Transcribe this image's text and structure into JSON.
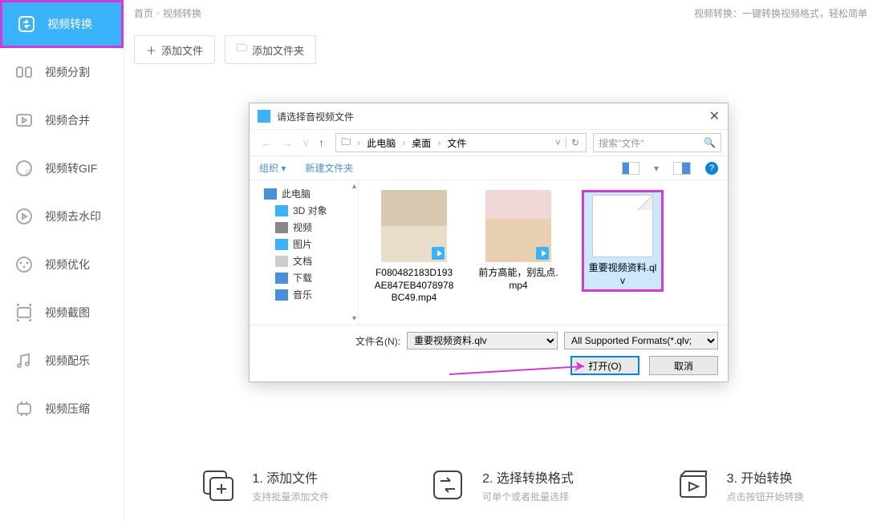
{
  "sidebar": {
    "items": [
      {
        "label": "视频转换"
      },
      {
        "label": "视频分割"
      },
      {
        "label": "视频合并"
      },
      {
        "label": "视频转GIF"
      },
      {
        "label": "视频去水印"
      },
      {
        "label": "视频优化"
      },
      {
        "label": "视频截图"
      },
      {
        "label": "视频配乐"
      },
      {
        "label": "视频压缩"
      }
    ]
  },
  "breadcrumb": {
    "home": "首页",
    "current": "视频转换"
  },
  "page_desc": "视频转换：一键转换视频格式，轻松简单",
  "toolbar": {
    "add_file": "添加文件",
    "add_folder": "添加文件夹"
  },
  "steps": [
    {
      "title": "1. 添加文件",
      "sub": "支持批量添加文件"
    },
    {
      "title": "2. 选择转换格式",
      "sub": "可单个或者批量选择"
    },
    {
      "title": "3. 开始转换",
      "sub": "点击按钮开始转换"
    }
  ],
  "dialog": {
    "title": "请选择音视频文件",
    "path": [
      "此电脑",
      "桌面",
      "文件"
    ],
    "search_placeholder": "搜索\"文件\"",
    "organize": "组织",
    "new_folder": "新建文件夹",
    "tree": [
      {
        "label": "此电脑"
      },
      {
        "label": "3D 对象"
      },
      {
        "label": "视频"
      },
      {
        "label": "图片"
      },
      {
        "label": "文档"
      },
      {
        "label": "下载"
      },
      {
        "label": "音乐"
      }
    ],
    "files": [
      {
        "name": "F080482183D193AE847EB4078978BC49.mp4"
      },
      {
        "name": "前方高能，别乱点.mp4"
      },
      {
        "name": "重要视频资料.qlv"
      }
    ],
    "filename_label": "文件名(N):",
    "filename_value": "重要视频资料.qlv",
    "filter": "All Supported Formats(*.qlv;",
    "open": "打开(O)",
    "cancel": "取消"
  }
}
